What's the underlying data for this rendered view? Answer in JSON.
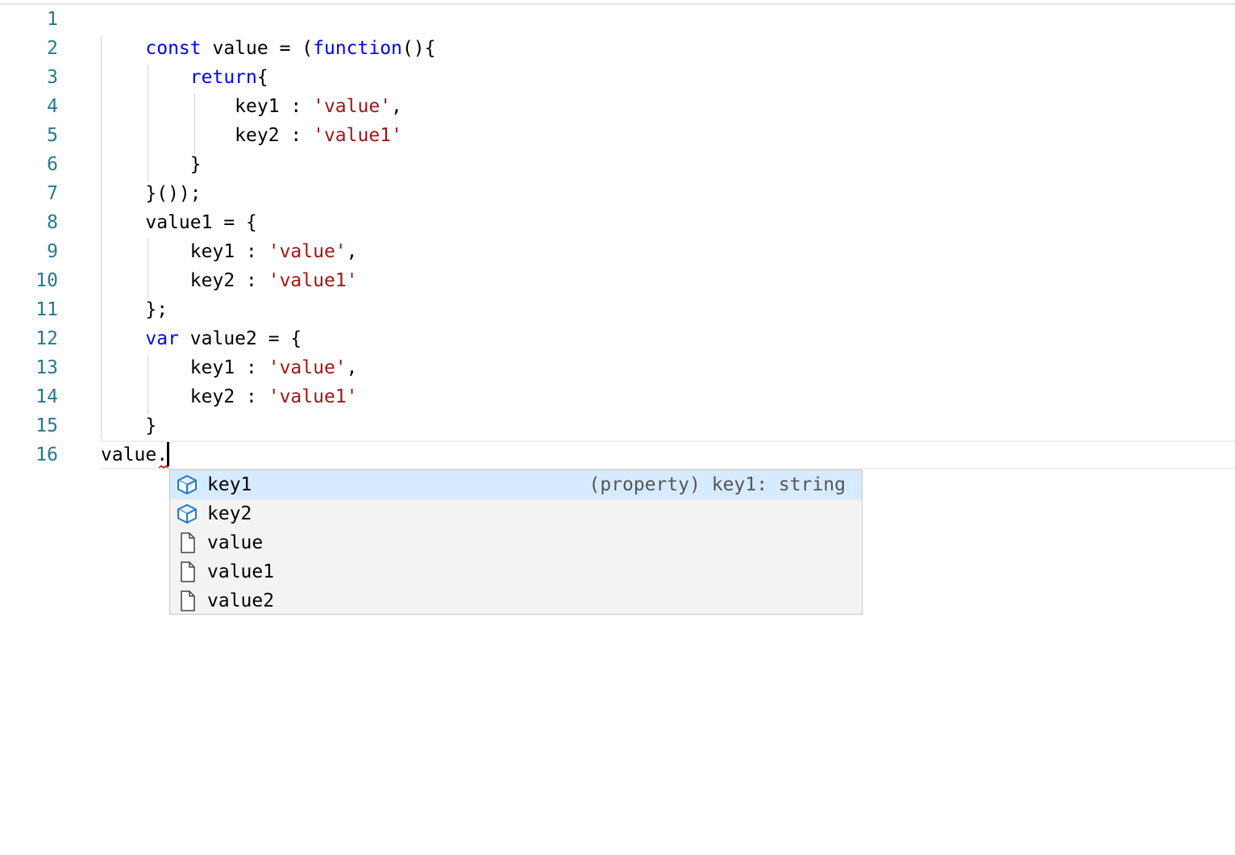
{
  "editor": {
    "line_numbers": [
      "1",
      "2",
      "3",
      "4",
      "5",
      "6",
      "7",
      "8",
      "9",
      "10",
      "11",
      "12",
      "13",
      "14",
      "15",
      "16"
    ],
    "lines": [
      [],
      [
        {
          "t": "    "
        },
        {
          "t": "const",
          "k": "kw"
        },
        {
          "t": " value = ("
        },
        {
          "t": "function",
          "k": "kw"
        },
        {
          "t": "(){"
        }
      ],
      [
        {
          "t": "        "
        },
        {
          "t": "return",
          "k": "kw"
        },
        {
          "t": "{"
        }
      ],
      [
        {
          "t": "            key1 : "
        },
        {
          "t": "'value'",
          "k": "str"
        },
        {
          "t": ","
        }
      ],
      [
        {
          "t": "            key2 : "
        },
        {
          "t": "'value1'",
          "k": "str"
        }
      ],
      [
        {
          "t": "        }"
        }
      ],
      [
        {
          "t": "    }());"
        }
      ],
      [
        {
          "t": "    value1 = {"
        }
      ],
      [
        {
          "t": "        key1 : "
        },
        {
          "t": "'value'",
          "k": "str"
        },
        {
          "t": ","
        }
      ],
      [
        {
          "t": "        key2 : "
        },
        {
          "t": "'value1'",
          "k": "str"
        }
      ],
      [
        {
          "t": "    };"
        }
      ],
      [
        {
          "t": "    "
        },
        {
          "t": "var",
          "k": "kw"
        },
        {
          "t": " value2 = {"
        }
      ],
      [
        {
          "t": "        key1 : "
        },
        {
          "t": "'value'",
          "k": "str"
        },
        {
          "t": ","
        }
      ],
      [
        {
          "t": "        key2 : "
        },
        {
          "t": "'value1'",
          "k": "str"
        }
      ],
      [
        {
          "t": "    }"
        }
      ],
      [
        {
          "t": "value."
        }
      ]
    ],
    "colors": {
      "line_number": "#237893",
      "keyword": "#0000ff",
      "string": "#a31515",
      "error_squiggle": "#e51400"
    }
  },
  "suggestions": {
    "items": [
      {
        "label": "key1",
        "icon": "property-cube-icon",
        "detail": "(property) key1: string",
        "selected": true
      },
      {
        "label": "key2",
        "icon": "property-cube-icon",
        "detail": "",
        "selected": false
      },
      {
        "label": "value",
        "icon": "document-icon",
        "detail": "",
        "selected": false
      },
      {
        "label": "value1",
        "icon": "document-icon",
        "detail": "",
        "selected": false
      },
      {
        "label": "value2",
        "icon": "document-icon",
        "detail": "",
        "selected": false
      }
    ],
    "colors": {
      "selected_background": "#d6ebff",
      "widget_background": "#f3f3f3",
      "property_icon": "#1e78c8"
    }
  }
}
